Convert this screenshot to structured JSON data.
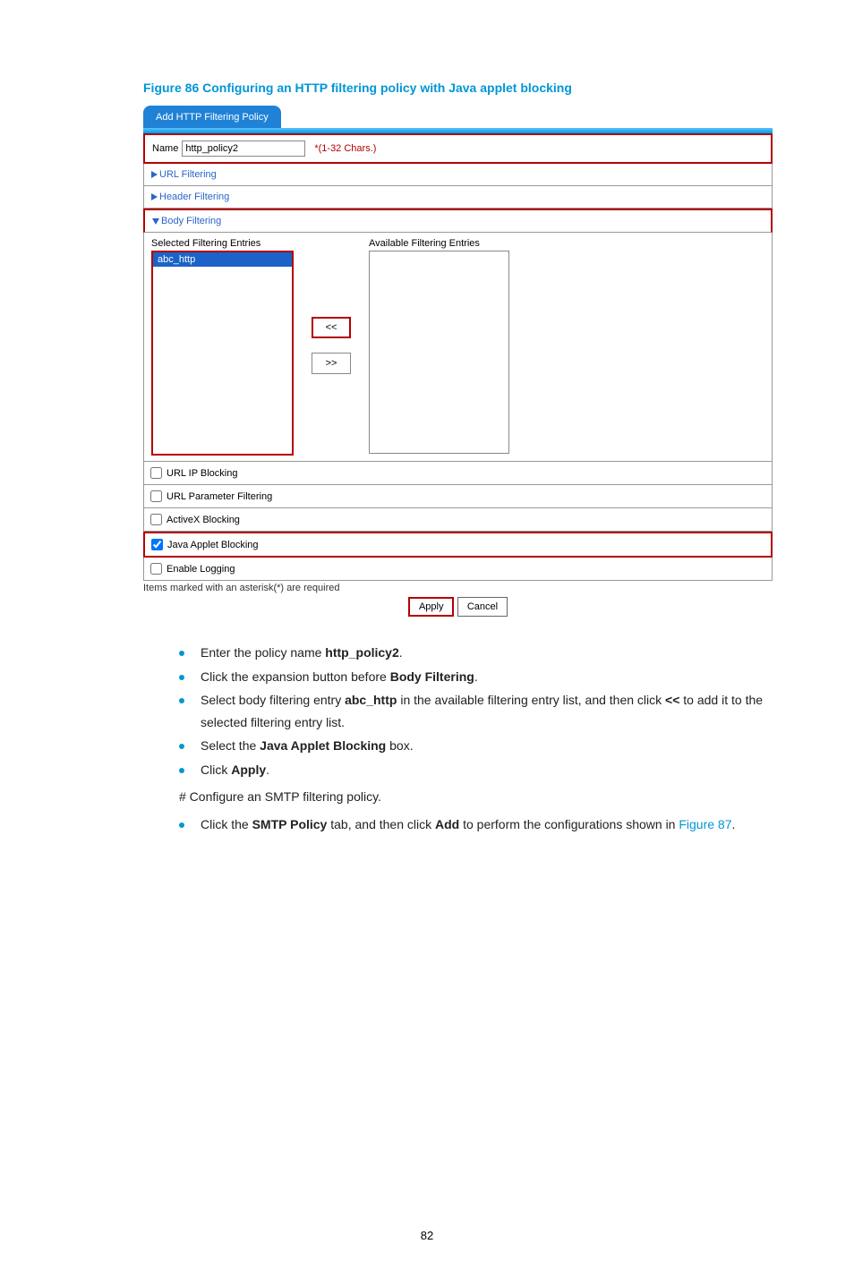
{
  "figure_title": "Figure 86 Configuring an HTTP filtering policy with Java applet blocking",
  "tab_label": "Add HTTP Filtering Policy",
  "name_label": "Name",
  "name_value": "http_policy2",
  "name_hint": "*(1-32 Chars.)",
  "url_filtering_label": "URL Filtering",
  "header_filtering_label": "Header Filtering",
  "body_filtering_label": "Body Filtering",
  "selected_entries_label": "Selected Filtering Entries",
  "available_entries_label": "Available Filtering Entries",
  "selected_entry": "abc_http",
  "btn_add": "<<",
  "btn_remove": ">>",
  "url_ip_blocking_label": "URL IP Blocking",
  "url_param_filtering_label": "URL Parameter Filtering",
  "activex_blocking_label": "ActiveX Blocking",
  "java_applet_blocking_label": "Java Applet Blocking",
  "enable_logging_label": "Enable Logging",
  "required_note": "Items marked with an asterisk(*) are required",
  "apply_label": "Apply",
  "cancel_label": "Cancel",
  "steps": {
    "s1_pre": "Enter the policy name ",
    "s1_bold": "http_policy2",
    "s1_post": ".",
    "s2_pre": "Click the expansion button before ",
    "s2_bold": "Body Filtering",
    "s2_post": ".",
    "s3_pre": "Select body filtering entry ",
    "s3_bold": "abc_http",
    "s3_mid": " in the available filtering entry list, and then click ",
    "s3_bold2": "<<",
    "s3_post": " to add it to the selected filtering entry list.",
    "s4_pre": "Select the ",
    "s4_bold": "Java Applet Blocking",
    "s4_post": " box.",
    "s5_pre": "Click ",
    "s5_bold": "Apply",
    "s5_post": ".",
    "config_line": "# Configure an SMTP filtering policy.",
    "s6_pre": "Click the ",
    "s6_bold": "SMTP Policy",
    "s6_mid": " tab, and then click ",
    "s6_bold2": "Add",
    "s6_mid2": " to perform the configurations shown in ",
    "s6_link": "Figure 87",
    "s6_post": "."
  },
  "page_number": "82"
}
